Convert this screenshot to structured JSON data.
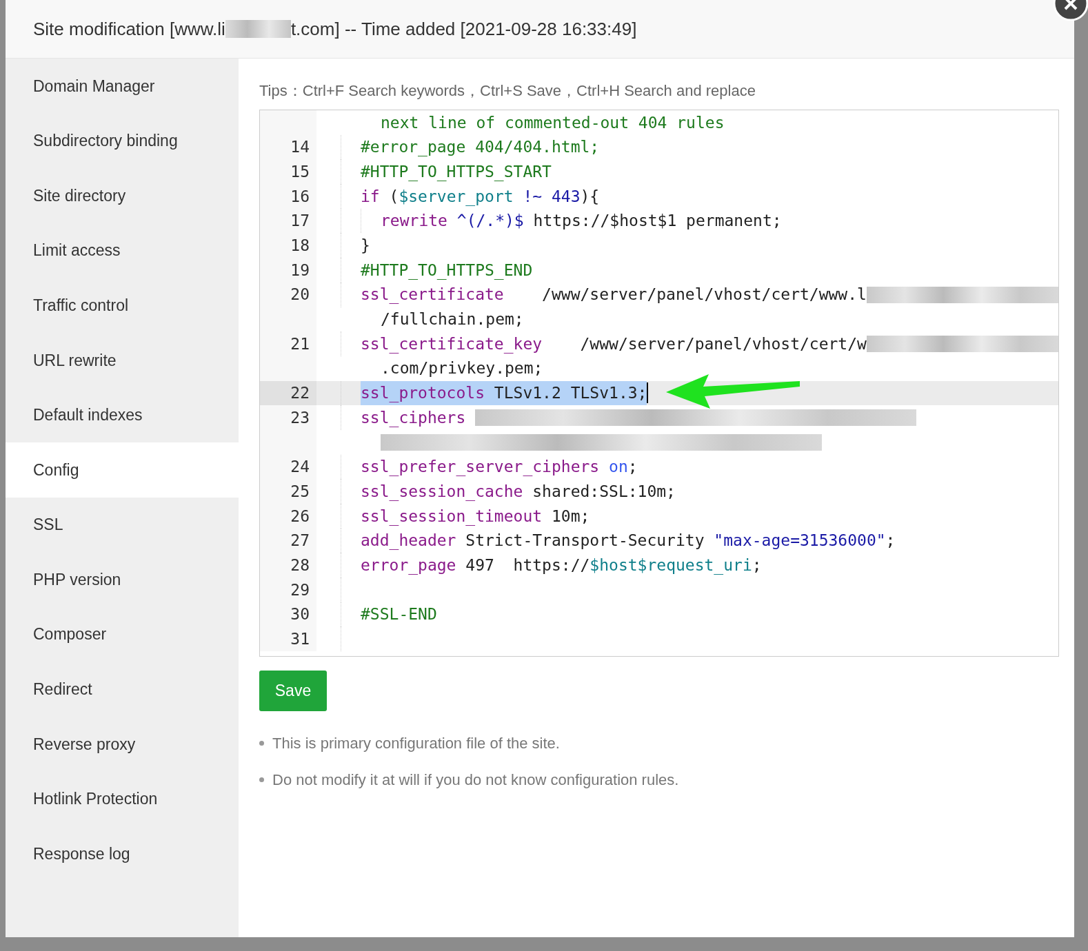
{
  "dialog": {
    "title_start": "Site modification [www.li",
    "title_end": "t.com] -- Time added [2021-09-28 16:33:49]"
  },
  "sidebar": {
    "items": [
      {
        "label": "Domain Manager",
        "selected": false
      },
      {
        "label": "Subdirectory binding",
        "selected": false
      },
      {
        "label": "Site directory",
        "selected": false
      },
      {
        "label": "Limit access",
        "selected": false
      },
      {
        "label": "Traffic control",
        "selected": false
      },
      {
        "label": "URL rewrite",
        "selected": false
      },
      {
        "label": "Default indexes",
        "selected": false
      },
      {
        "label": "Config",
        "selected": true
      },
      {
        "label": "SSL",
        "selected": false
      },
      {
        "label": "PHP version",
        "selected": false
      },
      {
        "label": "Composer",
        "selected": false
      },
      {
        "label": "Redirect",
        "selected": false
      },
      {
        "label": "Reverse proxy",
        "selected": false
      },
      {
        "label": "Hotlink Protection",
        "selected": false
      },
      {
        "label": "Response log",
        "selected": false
      }
    ]
  },
  "tips": "Tips：Ctrl+F Search keywords，Ctrl+S Save，Ctrl+H Search and replace",
  "editor": {
    "lines": [
      {
        "kind": "continuation",
        "active": false,
        "tokens": [
          {
            "kind": "comment",
            "text": "next line of commented-out 404 rules"
          }
        ]
      },
      {
        "kind": "line",
        "number": "14",
        "active": false,
        "tokens": [
          {
            "kind": "comment",
            "text": "#error_page 404/404.html;"
          }
        ]
      },
      {
        "kind": "line",
        "number": "15",
        "active": false,
        "tokens": [
          {
            "kind": "comment",
            "text": "#HTTP_TO_HTTPS_START"
          }
        ]
      },
      {
        "kind": "line",
        "number": "16",
        "active": false,
        "tokens": [
          {
            "kind": "keyword",
            "text": "if"
          },
          {
            "kind": "plain",
            "text": " ("
          },
          {
            "kind": "variable",
            "text": "$server_port"
          },
          {
            "kind": "number",
            "text": " !~ 443"
          },
          {
            "kind": "plain",
            "text": "){"
          }
        ],
        "children": [
          {
            "kind": "line",
            "number": "17",
            "active": false,
            "tokens": [
              {
                "kind": "keyword",
                "text": "rewrite"
              },
              {
                "kind": "number",
                "text": " ^(/.*)$"
              },
              {
                "kind": "plain",
                "text": " https://$host$1 permanent;"
              }
            ]
          }
        ]
      },
      {
        "kind": "line",
        "number": "18",
        "active": false,
        "tokens": [
          {
            "kind": "plain",
            "text": "}"
          }
        ]
      },
      {
        "kind": "line",
        "number": "19",
        "active": false,
        "tokens": [
          {
            "kind": "comment",
            "text": "#HTTP_TO_HTTPS_END"
          }
        ]
      },
      {
        "kind": "line",
        "number": "20",
        "active": false,
        "tokens": [
          {
            "kind": "keyword",
            "text": "ssl_certificate"
          },
          {
            "kind": "plain",
            "text": "    /www/server/panel/vhost/cert/www.l"
          },
          {
            "kind": "redacted"
          }
        ]
      },
      {
        "kind": "continuation",
        "active": false,
        "tokens": [
          {
            "kind": "plain",
            "text": "/fullchain.pem;"
          }
        ]
      },
      {
        "kind": "line",
        "number": "21",
        "active": false,
        "tokens": [
          {
            "kind": "keyword",
            "text": "ssl_certificate_key"
          },
          {
            "kind": "plain",
            "text": "    /www/server/panel/vhost/cert/w"
          },
          {
            "kind": "redacted"
          }
        ]
      },
      {
        "kind": "continuation",
        "active": false,
        "tokens": [
          {
            "kind": "plain",
            "text": ".com/privkey.pem;"
          }
        ]
      },
      {
        "kind": "line",
        "number": "22",
        "active": true,
        "tokens": [
          {
            "kind": "keyword",
            "text": "ssl_protocols"
          },
          {
            "kind": "plain",
            "text": " TLSv1.2 TLSv1.3;"
          }
        ]
      },
      {
        "kind": "line",
        "number": "23",
        "active": false,
        "tokens": [
          {
            "kind": "keyword",
            "text": "ssl_ciphers "
          },
          {
            "kind": "redacted"
          }
        ]
      },
      {
        "kind": "continuation",
        "active": false,
        "tokens": [
          {
            "kind": "redacted"
          }
        ]
      },
      {
        "kind": "line",
        "number": "24",
        "active": false,
        "tokens": [
          {
            "kind": "keyword",
            "text": "ssl_prefer_server_ciphers"
          },
          {
            "kind": "atom",
            "text": " on"
          },
          {
            "kind": "plain",
            "text": ";"
          }
        ]
      },
      {
        "kind": "line",
        "number": "25",
        "active": false,
        "tokens": [
          {
            "kind": "keyword",
            "text": "ssl_session_cache"
          },
          {
            "kind": "plain",
            "text": " shared:SSL:10m;"
          }
        ]
      },
      {
        "kind": "line",
        "number": "26",
        "active": false,
        "tokens": [
          {
            "kind": "keyword",
            "text": "ssl_session_timeout"
          },
          {
            "kind": "plain",
            "text": " 10m;"
          }
        ]
      },
      {
        "kind": "line",
        "number": "27",
        "active": false,
        "tokens": [
          {
            "kind": "keyword",
            "text": "add_header"
          },
          {
            "kind": "plain",
            "text": " Strict-Transport-Security "
          },
          {
            "kind": "string",
            "text": "\"max-age=31536000\""
          },
          {
            "kind": "plain",
            "text": ";"
          }
        ]
      },
      {
        "kind": "line",
        "number": "28",
        "active": false,
        "tokens": [
          {
            "kind": "keyword",
            "text": "error_page"
          },
          {
            "kind": "plain",
            "text": " 497  https://"
          },
          {
            "kind": "variable",
            "text": "$host$request_uri"
          },
          {
            "kind": "plain",
            "text": ";"
          }
        ]
      },
      {
        "kind": "line",
        "number": "29",
        "active": false
      },
      {
        "kind": "line",
        "number": "30",
        "active": false,
        "tokens": [
          {
            "kind": "comment",
            "text": "#SSL-END"
          }
        ]
      },
      {
        "kind": "line",
        "number": "31",
        "active": false
      }
    ]
  },
  "save_button": "Save",
  "notes": [
    "This is primary configuration file of the site.",
    "Do not modify it at will if you do not know configuration rules."
  ]
}
